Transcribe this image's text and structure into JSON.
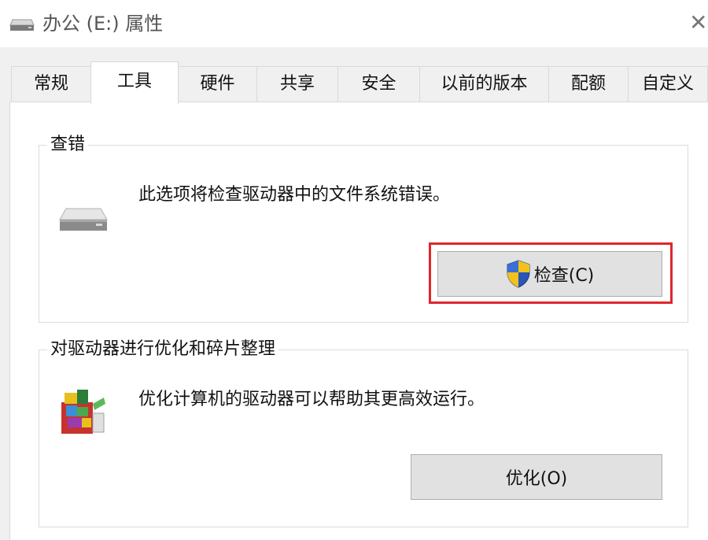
{
  "window": {
    "title": "办公 (E:) 属性",
    "close_glyph": "✕"
  },
  "tabs": [
    {
      "label": "常规",
      "active": false
    },
    {
      "label": "工具",
      "active": true
    },
    {
      "label": "硬件",
      "active": false
    },
    {
      "label": "共享",
      "active": false
    },
    {
      "label": "安全",
      "active": false
    },
    {
      "label": "以前的版本",
      "active": false
    },
    {
      "label": "配额",
      "active": false
    },
    {
      "label": "自定义",
      "active": false
    }
  ],
  "error_check": {
    "title": "查错",
    "description": "此选项将检查驱动器中的文件系统错误。",
    "button_label": "检查(C)",
    "icon": "drive-icon",
    "button_icon": "uac-shield-icon",
    "highlighted": true
  },
  "optimize": {
    "title": "对驱动器进行优化和碎片整理",
    "description": "优化计算机的驱动器可以帮助其更高效运行。",
    "button_label": "优化(O)",
    "icon": "defrag-icon"
  },
  "colors": {
    "highlight": "#e0262a",
    "dialog_bg": "#f0f0f0",
    "button_bg": "#e1e1e1"
  }
}
